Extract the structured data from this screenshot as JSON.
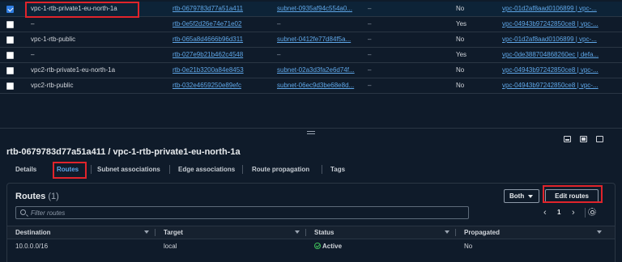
{
  "route_tables": [
    {
      "selected": true,
      "name": "vpc-1-rtb-private1-eu-north-1a",
      "id": "rtb-0679783d77a51a411",
      "subnet": "subnet-0935af94c554a0...",
      "sep": "–",
      "main": "No",
      "vpc": "vpc-01d2af8aad0106899 | vpc-..."
    },
    {
      "selected": false,
      "name": "–",
      "id": "rtb-0e5f2d26e74e71e02",
      "subnet": "–",
      "sep": "–",
      "main": "Yes",
      "vpc": "vpc-04943b97242850ce8 | vpc-..."
    },
    {
      "selected": false,
      "name": "vpc-1-rtb-public",
      "id": "rtb-065a8d4666b96d311",
      "subnet": "subnet-0412fe77d84f5a...",
      "sep": "–",
      "main": "No",
      "vpc": "vpc-01d2af8aad0106899 | vpc-..."
    },
    {
      "selected": false,
      "name": "–",
      "id": "rtb-027e9b21b462c4548",
      "subnet": "–",
      "sep": "–",
      "main": "Yes",
      "vpc": "vpc-0de388704868260ec | defa..."
    },
    {
      "selected": false,
      "name": "vpc2-rtb-private1-eu-north-1a",
      "id": "rtb-0e21b3200a84e8453",
      "subnet": "subnet-02a3d3fa2e6d74f...",
      "sep": "–",
      "main": "No",
      "vpc": "vpc-04943b97242850ce8 | vpc-..."
    },
    {
      "selected": false,
      "name": "vpc2-rtb-public",
      "id": "rtb-032e4659250e89efc",
      "subnet": "subnet-06ec9d3be68e8d...",
      "sep": "–",
      "main": "No",
      "vpc": "vpc-04943b97242850ce8 | vpc-..."
    }
  ],
  "details": {
    "title": "rtb-0679783d77a51a411 / vpc-1-rtb-private1-eu-north-1a",
    "tabs": [
      "Details",
      "Routes",
      "Subnet associations",
      "Edge associations",
      "Route propagation",
      "Tags"
    ],
    "active_tab": "Routes"
  },
  "routes": {
    "title": "Routes",
    "count": "(1)",
    "both_label": "Both",
    "edit_label": "Edit routes",
    "filter_placeholder": "Filter routes",
    "page": "1",
    "columns": [
      "Destination",
      "Target",
      "Status",
      "Propagated"
    ],
    "rows": [
      {
        "destination": "10.0.0.0/16",
        "target": "local",
        "status": "Active",
        "propagated": "No"
      }
    ]
  },
  "colors": {
    "accent": "#5fa7e8",
    "highlight": "#e0242b",
    "status_active": "#3fbf5a"
  }
}
